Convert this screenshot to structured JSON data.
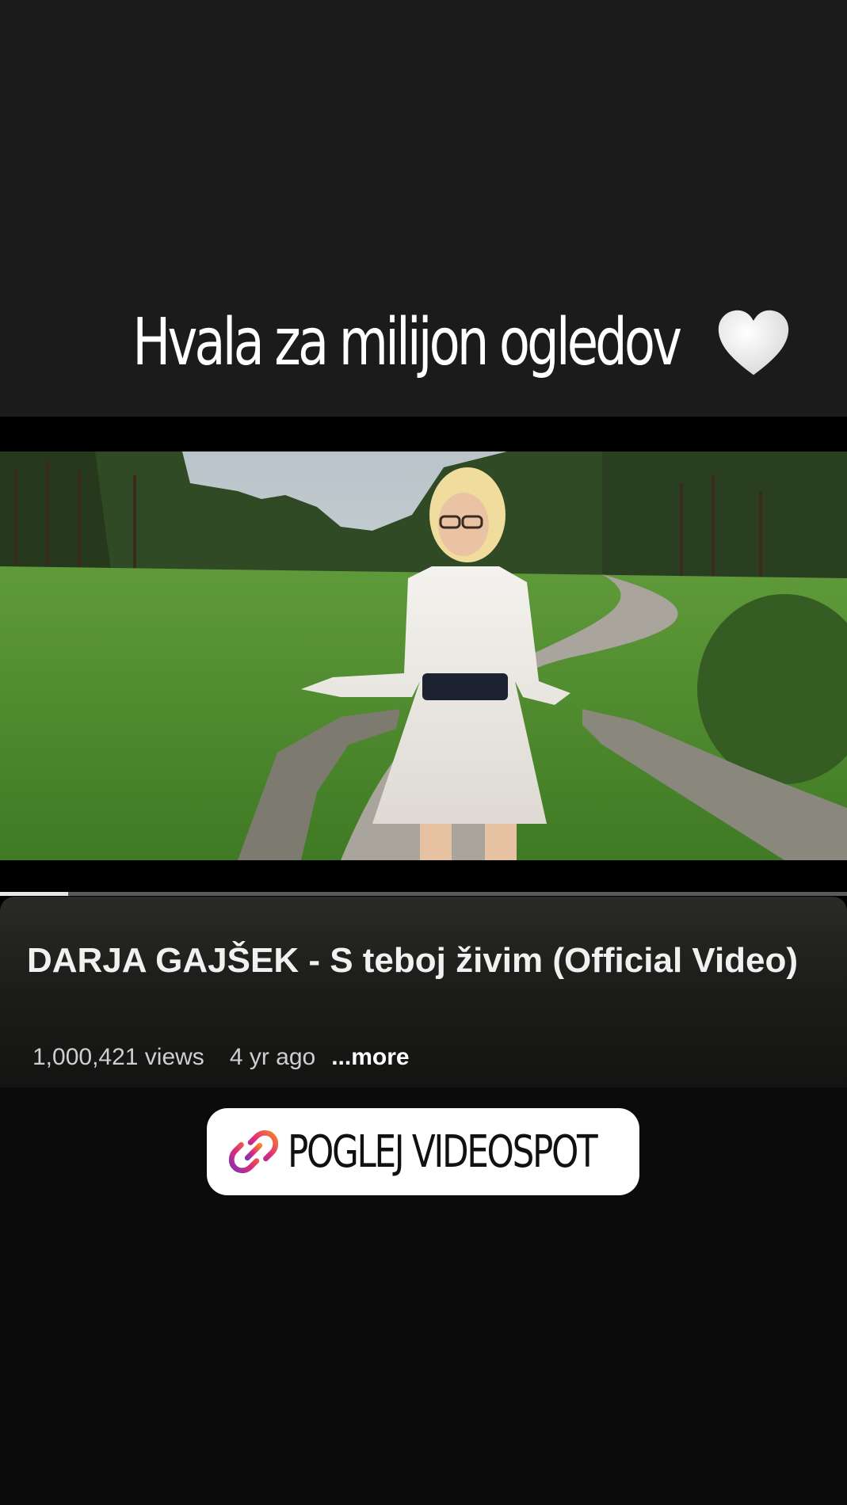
{
  "story": {
    "caption": "Hvala za milijon ogledov",
    "caption_icon": "white-heart-icon"
  },
  "video": {
    "title": "DARJA GAJŠEK - S teboj živim (Official Video)",
    "views": "1,000,421 views",
    "age": "4 yr ago",
    "more_label": "...more",
    "progress": 0.08
  },
  "link_sticker": {
    "label": "POGLEJ VIDEOSPOT",
    "icon": "link-icon"
  },
  "colors": {
    "background_top": "#1c1c1d",
    "background_bottom": "#0b0b0b",
    "sticker_bg": "#ffffff",
    "link_icon_gradient": [
      "#f58529",
      "#dd2a7b",
      "#8134af"
    ]
  }
}
